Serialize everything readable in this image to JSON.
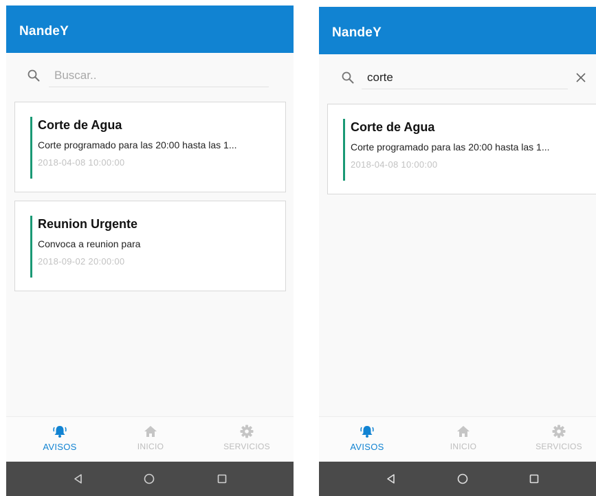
{
  "colors": {
    "app_bar": "#1183d2",
    "card_accent": "#1a9975",
    "nav_active": "#1183d2",
    "nav_inactive": "#bdbdbd",
    "system_bar": "#4a4a4a"
  },
  "screens": [
    {
      "app_title": "NandeY",
      "search": {
        "placeholder": "Buscar..",
        "value": ""
      },
      "notices": [
        {
          "title": "Corte de Agua",
          "description": "Corte programado para las 20:00 hasta las 1...",
          "date": "2018-04-08 10:00:00"
        },
        {
          "title": "Reunion Urgente",
          "description": "Convoca a reunion para",
          "date": "2018-09-02 20:00:00"
        }
      ],
      "nav": [
        {
          "label": "AVISOS",
          "icon": "bell-icon",
          "active": true
        },
        {
          "label": "INICIO",
          "icon": "home-icon",
          "active": false
        },
        {
          "label": "SERVICIOS",
          "icon": "gear-icon",
          "active": false
        }
      ]
    },
    {
      "app_title": "NandeY",
      "search": {
        "placeholder": "Buscar..",
        "value": "corte"
      },
      "notices": [
        {
          "title": "Corte de Agua",
          "description": "Corte programado para las 20:00 hasta las 1...",
          "date": "2018-04-08 10:00:00"
        }
      ],
      "nav": [
        {
          "label": "AVISOS",
          "icon": "bell-icon",
          "active": true
        },
        {
          "label": "INICIO",
          "icon": "home-icon",
          "active": false
        },
        {
          "label": "SERVICIOS",
          "icon": "gear-icon",
          "active": false
        }
      ]
    }
  ],
  "system_nav": {
    "back_icon": "back-triangle-icon",
    "home_icon": "home-circle-icon",
    "recents_icon": "recents-square-icon"
  }
}
